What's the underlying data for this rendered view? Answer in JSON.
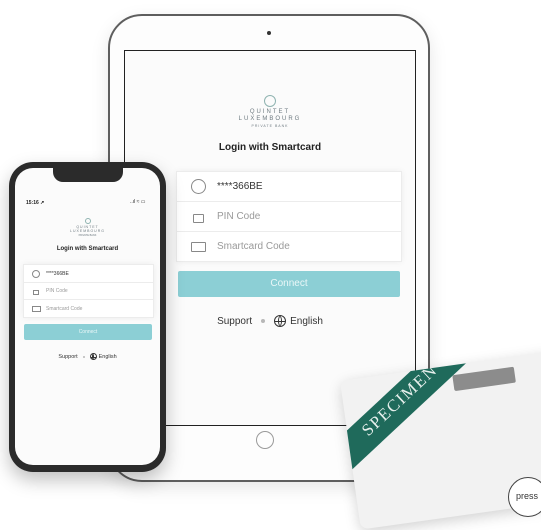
{
  "tablet": {
    "logo": {
      "line1": "QUINTET",
      "line2": "LUXEMBOURG",
      "line3": "PRIVATE BANK"
    },
    "title": "Login with Smartcard",
    "fields": {
      "user": {
        "icon": "user-icon",
        "value": "****366BE"
      },
      "pin": {
        "icon": "lock-icon",
        "placeholder": "PIN Code"
      },
      "smartcard": {
        "icon": "card-icon",
        "placeholder": "Smartcard Code"
      }
    },
    "connect_label": "Connect",
    "support_label": "Support",
    "language_label": "English"
  },
  "phone": {
    "status": {
      "time": "15:16 ↗",
      "icons": "..ıl ≈ ▭"
    },
    "logo": {
      "line1": "QUINTET",
      "line2": "LUXEMBOURG",
      "line3": "PRIVATE BANK"
    },
    "title": "Login with Smartcard",
    "fields": {
      "user": {
        "value": "****366BE"
      },
      "pin": {
        "placeholder": "PIN Code"
      },
      "smartcard": {
        "placeholder": "Smartcard Code"
      }
    },
    "connect_label": "Connect",
    "support_label": "Support",
    "language_label": "English"
  },
  "card": {
    "text": "SPECIMEN",
    "band_color": "#1f6a5b"
  },
  "press_badge": "press",
  "colors": {
    "accent": "#8ccfd5",
    "text": "#222222",
    "placeholder": "#9a9a9a"
  }
}
